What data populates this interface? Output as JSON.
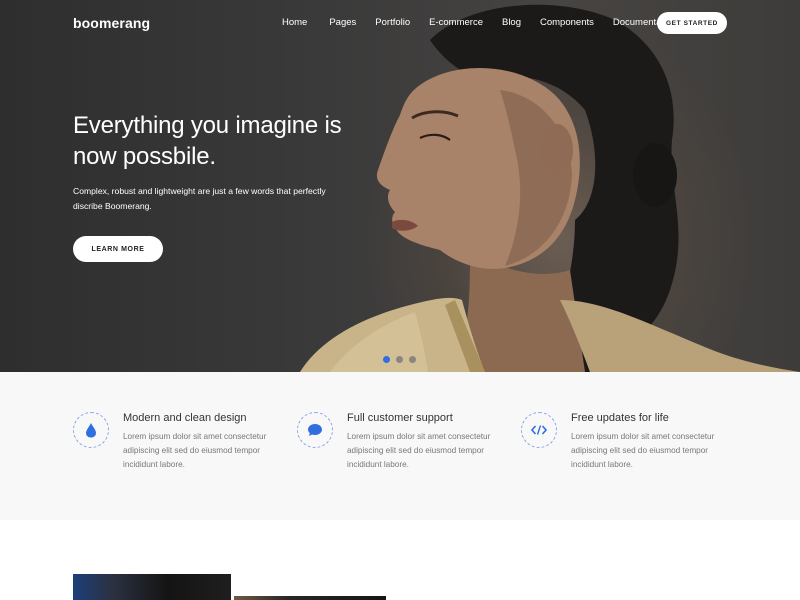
{
  "brand": {
    "logo_text": "boomerang"
  },
  "nav": {
    "links": [
      "Home",
      "Pages",
      "Portfolio",
      "E-commerce",
      "Blog",
      "Components",
      "Documentation"
    ],
    "cta": "GET STARTED"
  },
  "hero": {
    "title": "Everything you imagine is now possbile.",
    "subtitle": "Complex, robust and lightweight are just a few words that perfectly discribe Boomerang.",
    "button": "LEARN MORE",
    "slides_count": 3,
    "active_slide": 1
  },
  "features": [
    {
      "icon": "drop-icon",
      "title": "Modern and clean design",
      "description": "Lorem ipsum dolor sit amet consectetur adipiscing elit sed do eiusmod tempor incididunt labore."
    },
    {
      "icon": "chat-icon",
      "title": "Full customer support",
      "description": "Lorem ipsum dolor sit amet consectetur adipiscing elit sed do eiusmod tempor incididunt labore."
    },
    {
      "icon": "code-icon",
      "title": "Free updates for life",
      "description": "Lorem ipsum dolor sit amet consectetur adipiscing elit sed do eiusmod tempor incididunt labore."
    }
  ],
  "colors": {
    "accent": "#2f6fe0",
    "feature_bg": "#f8f8f9",
    "hero_bg": "#3a3a3a"
  }
}
